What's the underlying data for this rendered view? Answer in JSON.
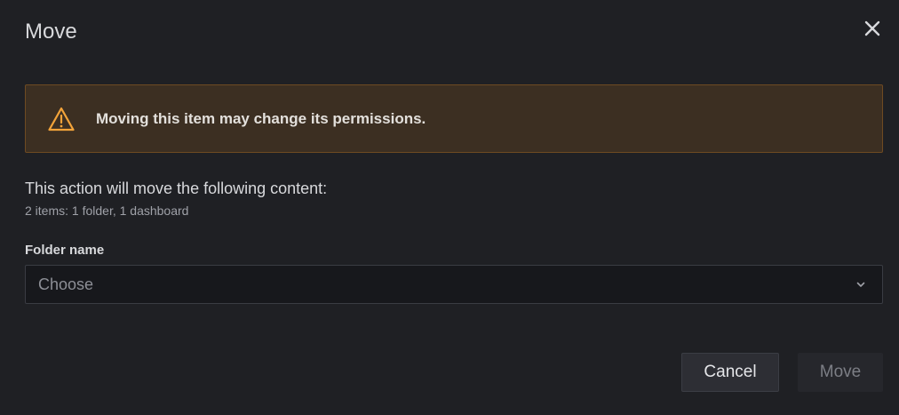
{
  "modal": {
    "title": "Move",
    "close_icon": "close-icon"
  },
  "alert": {
    "icon": "warning-icon",
    "text": "Moving this item may change its permissions.",
    "colors": {
      "background": "#3c2f22",
      "border": "#6e4a22",
      "icon": "#f2a33a"
    }
  },
  "content": {
    "description": "This action will move the following content:",
    "count": "2 items: 1 folder, 1 dashboard"
  },
  "folder_field": {
    "label": "Folder name",
    "placeholder": "Choose",
    "chevron_icon": "chevron-down-icon"
  },
  "footer": {
    "cancel_label": "Cancel",
    "move_label": "Move"
  }
}
